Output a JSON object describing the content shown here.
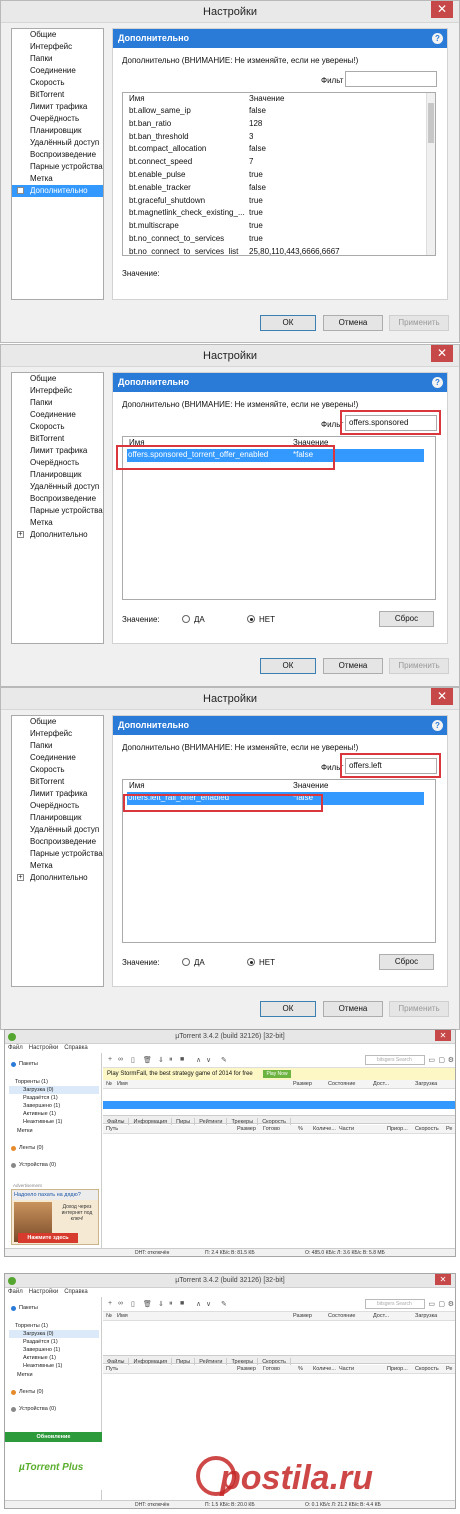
{
  "dialog": {
    "title": "Настройки",
    "close": "✕",
    "tree": [
      "Общие",
      "Интерфейс",
      "Папки",
      "Соединение",
      "Скорость",
      "BitTorrent",
      "Лимит трафика",
      "Очерёдность",
      "Планировщик",
      "Удалённый доступ",
      "Воспроизведение",
      "Парные устройства",
      "Метка",
      "Дополнительно"
    ],
    "panel_title": "Дополнительно",
    "help": "?",
    "warning": "Дополнительно (ВНИМАНИЕ: Не изменяйте, если не уверены!)",
    "filter_label": "Фильт",
    "col_name": "Имя",
    "col_value": "Значение",
    "value_label": "Значение:",
    "yes": "ДА",
    "no": "НЕТ",
    "reset": "Сброс",
    "ok": "ОК",
    "cancel": "Отмена",
    "apply": "Применить"
  },
  "screen1": {
    "filter": "",
    "rows": [
      [
        "bt.allow_same_ip",
        "false"
      ],
      [
        "bt.ban_ratio",
        "128"
      ],
      [
        "bt.ban_threshold",
        "3"
      ],
      [
        "bt.compact_allocation",
        "false"
      ],
      [
        "bt.connect_speed",
        "7"
      ],
      [
        "bt.enable_pulse",
        "true"
      ],
      [
        "bt.enable_tracker",
        "false"
      ],
      [
        "bt.graceful_shutdown",
        "true"
      ],
      [
        "bt.magnetlink_check_existing_...",
        "true"
      ],
      [
        "bt.multiscrape",
        "true"
      ],
      [
        "bt.no_connect_to_services",
        "true"
      ],
      [
        "bt.no_connect_to_services_list",
        "25,80,110,443,6666,6667"
      ]
    ]
  },
  "screen2": {
    "filter": "offers.sponsored",
    "row": [
      "offers.sponsored_torrent_offer_enabled",
      "*false"
    ]
  },
  "screen3": {
    "filter": "offers.left",
    "row": [
      "offers.left_rail_offer_enabled",
      "*false"
    ]
  },
  "ut": {
    "title": "µTorrent 3.4.2  (build 32126) [32-bit]",
    "menu": [
      "Файл",
      "Настройки",
      "Справка"
    ],
    "side": {
      "packs": "Пакеты",
      "torrents": "Торренты (1)",
      "downloads": "Загрузка (0)",
      "seeding": "Раздаётся (1)",
      "completed": "Завершено (1)",
      "active": "Активные (1)",
      "inactive": "Неактивные (1)",
      "labels": "Метки",
      "feeds": "Ленты (0)",
      "devices": "Устройства (0)"
    },
    "search": "bitsgers Search",
    "ad_text": "Play StormFall, the best strategy game of 2014 for free",
    "play_now": "Play Now",
    "cols": [
      "№",
      "Имя",
      "Размер",
      "Состояние",
      "Дост...",
      "Загрузка"
    ],
    "tabs": [
      "Файлы",
      "Информация",
      "Пиры",
      "Рейтинги",
      "Трекеры",
      "Скорость"
    ],
    "file_cols": [
      "Путь",
      "Размер",
      "Готово",
      "%",
      "Количе...",
      "Части",
      "Приор...",
      "Скорость",
      "Ре"
    ],
    "ad": {
      "label": "Advertisement",
      "head": "Надоело пахать на дядю?",
      "body": "Доход через интернет под ключ!",
      "go": "Нажмите здесь"
    },
    "update": "Обновление",
    "plus": "µTorrent Plus",
    "status1": {
      "dht": "DHT: отключён",
      "down": "П: 2.4 КБ/с В: 81.5 КБ",
      "up": "О: 485.0 КБ/с Л: 3.6 КБ/с В: 5.8 МБ"
    },
    "status2": {
      "dht": "DHT: отключён",
      "down": "П: 1.5 КБ/с В: 20.0 КБ",
      "up": "О: 0.1 КБ/с Л: 21.2 КБ/с В: 4.4 КБ"
    }
  },
  "watermark": "postila.ru"
}
